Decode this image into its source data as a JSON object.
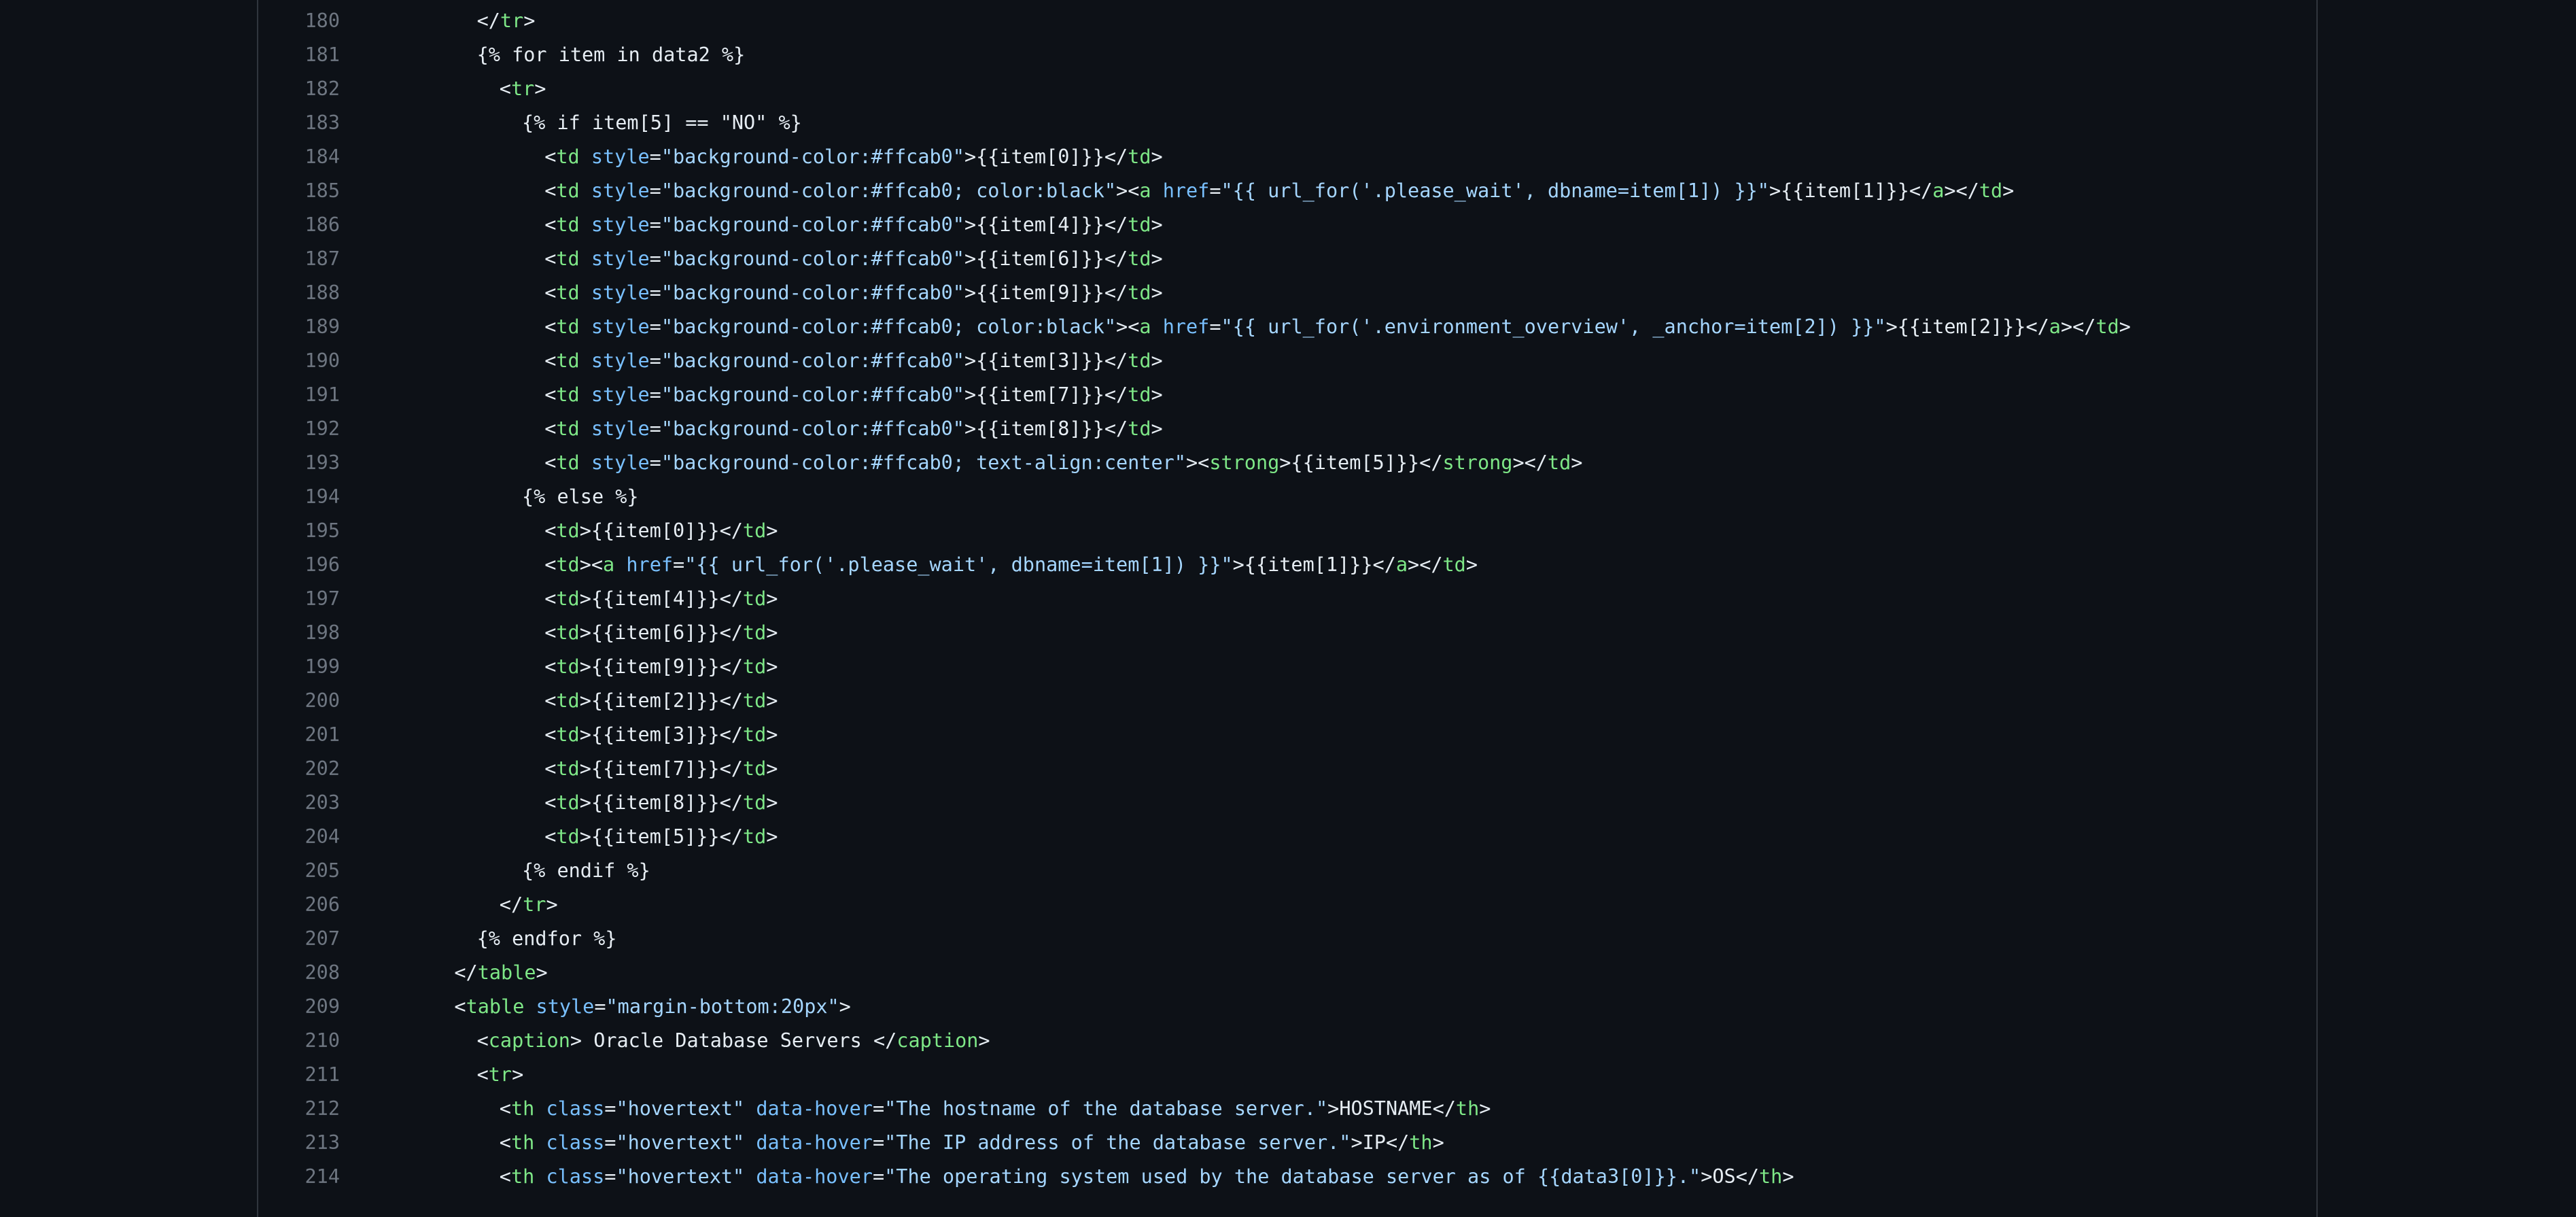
{
  "colors": {
    "background": "#0d1117",
    "line_number": "#6e7681",
    "text": "#e6edf3",
    "tag": "#7ee787",
    "attribute": "#79c0ff",
    "string": "#a5d6ff"
  },
  "lines": [
    {
      "num": "180",
      "indent": 6,
      "tokens": [
        [
          "p",
          "</"
        ],
        [
          "t",
          "tr"
        ],
        [
          "p",
          ">"
        ]
      ]
    },
    {
      "num": "181",
      "indent": 6,
      "tokens": [
        [
          "p",
          "{% for item in data2 %}"
        ]
      ]
    },
    {
      "num": "182",
      "indent": 8,
      "tokens": [
        [
          "p",
          "<"
        ],
        [
          "t",
          "tr"
        ],
        [
          "p",
          ">"
        ]
      ]
    },
    {
      "num": "183",
      "indent": 10,
      "tokens": [
        [
          "p",
          "{% if item[5] == \"NO\" %}"
        ]
      ]
    },
    {
      "num": "184",
      "indent": 12,
      "tokens": [
        [
          "p",
          "<"
        ],
        [
          "t",
          "td"
        ],
        [
          "p",
          " "
        ],
        [
          "a",
          "style"
        ],
        [
          "p",
          "="
        ],
        [
          "s",
          "\"background-color:#ffcab0\""
        ],
        [
          "p",
          ">{{item[0]}}</"
        ],
        [
          "t",
          "td"
        ],
        [
          "p",
          ">"
        ]
      ]
    },
    {
      "num": "185",
      "indent": 12,
      "tokens": [
        [
          "p",
          "<"
        ],
        [
          "t",
          "td"
        ],
        [
          "p",
          " "
        ],
        [
          "a",
          "style"
        ],
        [
          "p",
          "="
        ],
        [
          "s",
          "\"background-color:#ffcab0; color:black\""
        ],
        [
          "p",
          ">"
        ],
        [
          "p",
          "<"
        ],
        [
          "t",
          "a"
        ],
        [
          "p",
          " "
        ],
        [
          "a",
          "href"
        ],
        [
          "p",
          "="
        ],
        [
          "s",
          "\"{{ url_for('.please_wait', dbname=item[1]) }}\""
        ],
        [
          "p",
          ">{{item[1]}}</"
        ],
        [
          "t",
          "a"
        ],
        [
          "p",
          "></"
        ],
        [
          "t",
          "td"
        ],
        [
          "p",
          ">"
        ]
      ]
    },
    {
      "num": "186",
      "indent": 12,
      "tokens": [
        [
          "p",
          "<"
        ],
        [
          "t",
          "td"
        ],
        [
          "p",
          " "
        ],
        [
          "a",
          "style"
        ],
        [
          "p",
          "="
        ],
        [
          "s",
          "\"background-color:#ffcab0\""
        ],
        [
          "p",
          ">{{item[4]}}</"
        ],
        [
          "t",
          "td"
        ],
        [
          "p",
          ">"
        ]
      ]
    },
    {
      "num": "187",
      "indent": 12,
      "tokens": [
        [
          "p",
          "<"
        ],
        [
          "t",
          "td"
        ],
        [
          "p",
          " "
        ],
        [
          "a",
          "style"
        ],
        [
          "p",
          "="
        ],
        [
          "s",
          "\"background-color:#ffcab0\""
        ],
        [
          "p",
          ">{{item[6]}}</"
        ],
        [
          "t",
          "td"
        ],
        [
          "p",
          ">"
        ]
      ]
    },
    {
      "num": "188",
      "indent": 12,
      "tokens": [
        [
          "p",
          "<"
        ],
        [
          "t",
          "td"
        ],
        [
          "p",
          " "
        ],
        [
          "a",
          "style"
        ],
        [
          "p",
          "="
        ],
        [
          "s",
          "\"background-color:#ffcab0\""
        ],
        [
          "p",
          ">{{item[9]}}</"
        ],
        [
          "t",
          "td"
        ],
        [
          "p",
          ">"
        ]
      ]
    },
    {
      "num": "189",
      "indent": 12,
      "tokens": [
        [
          "p",
          "<"
        ],
        [
          "t",
          "td"
        ],
        [
          "p",
          " "
        ],
        [
          "a",
          "style"
        ],
        [
          "p",
          "="
        ],
        [
          "s",
          "\"background-color:#ffcab0; color:black\""
        ],
        [
          "p",
          ">"
        ],
        [
          "p",
          "<"
        ],
        [
          "t",
          "a"
        ],
        [
          "p",
          " "
        ],
        [
          "a",
          "href"
        ],
        [
          "p",
          "="
        ],
        [
          "s",
          "\"{{ url_for('.environment_overview', _anchor=item[2]) }}\""
        ],
        [
          "p",
          ">{{item[2]}}</"
        ],
        [
          "t",
          "a"
        ],
        [
          "p",
          "></"
        ],
        [
          "t",
          "td"
        ],
        [
          "p",
          ">"
        ]
      ]
    },
    {
      "num": "190",
      "indent": 12,
      "tokens": [
        [
          "p",
          "<"
        ],
        [
          "t",
          "td"
        ],
        [
          "p",
          " "
        ],
        [
          "a",
          "style"
        ],
        [
          "p",
          "="
        ],
        [
          "s",
          "\"background-color:#ffcab0\""
        ],
        [
          "p",
          ">{{item[3]}}</"
        ],
        [
          "t",
          "td"
        ],
        [
          "p",
          ">"
        ]
      ]
    },
    {
      "num": "191",
      "indent": 12,
      "tokens": [
        [
          "p",
          "<"
        ],
        [
          "t",
          "td"
        ],
        [
          "p",
          " "
        ],
        [
          "a",
          "style"
        ],
        [
          "p",
          "="
        ],
        [
          "s",
          "\"background-color:#ffcab0\""
        ],
        [
          "p",
          ">{{item[7]}}</"
        ],
        [
          "t",
          "td"
        ],
        [
          "p",
          ">"
        ]
      ]
    },
    {
      "num": "192",
      "indent": 12,
      "tokens": [
        [
          "p",
          "<"
        ],
        [
          "t",
          "td"
        ],
        [
          "p",
          " "
        ],
        [
          "a",
          "style"
        ],
        [
          "p",
          "="
        ],
        [
          "s",
          "\"background-color:#ffcab0\""
        ],
        [
          "p",
          ">{{item[8]}}</"
        ],
        [
          "t",
          "td"
        ],
        [
          "p",
          ">"
        ]
      ]
    },
    {
      "num": "193",
      "indent": 12,
      "tokens": [
        [
          "p",
          "<"
        ],
        [
          "t",
          "td"
        ],
        [
          "p",
          " "
        ],
        [
          "a",
          "style"
        ],
        [
          "p",
          "="
        ],
        [
          "s",
          "\"background-color:#ffcab0; text-align:center\""
        ],
        [
          "p",
          ">"
        ],
        [
          "p",
          "<"
        ],
        [
          "t",
          "strong"
        ],
        [
          "p",
          ">{{item[5]}}</"
        ],
        [
          "t",
          "strong"
        ],
        [
          "p",
          "></"
        ],
        [
          "t",
          "td"
        ],
        [
          "p",
          ">"
        ]
      ]
    },
    {
      "num": "194",
      "indent": 10,
      "tokens": [
        [
          "p",
          "{% else %}"
        ]
      ]
    },
    {
      "num": "195",
      "indent": 12,
      "tokens": [
        [
          "p",
          "<"
        ],
        [
          "t",
          "td"
        ],
        [
          "p",
          ">{{item[0]}}</"
        ],
        [
          "t",
          "td"
        ],
        [
          "p",
          ">"
        ]
      ]
    },
    {
      "num": "196",
      "indent": 12,
      "tokens": [
        [
          "p",
          "<"
        ],
        [
          "t",
          "td"
        ],
        [
          "p",
          ">"
        ],
        [
          "p",
          "<"
        ],
        [
          "t",
          "a"
        ],
        [
          "p",
          " "
        ],
        [
          "a",
          "href"
        ],
        [
          "p",
          "="
        ],
        [
          "s",
          "\"{{ url_for('.please_wait', dbname=item[1]) }}\""
        ],
        [
          "p",
          ">{{item[1]}}</"
        ],
        [
          "t",
          "a"
        ],
        [
          "p",
          "></"
        ],
        [
          "t",
          "td"
        ],
        [
          "p",
          ">"
        ]
      ]
    },
    {
      "num": "197",
      "indent": 12,
      "tokens": [
        [
          "p",
          "<"
        ],
        [
          "t",
          "td"
        ],
        [
          "p",
          ">{{item[4]}}</"
        ],
        [
          "t",
          "td"
        ],
        [
          "p",
          ">"
        ]
      ]
    },
    {
      "num": "198",
      "indent": 12,
      "tokens": [
        [
          "p",
          "<"
        ],
        [
          "t",
          "td"
        ],
        [
          "p",
          ">{{item[6]}}</"
        ],
        [
          "t",
          "td"
        ],
        [
          "p",
          ">"
        ]
      ]
    },
    {
      "num": "199",
      "indent": 12,
      "tokens": [
        [
          "p",
          "<"
        ],
        [
          "t",
          "td"
        ],
        [
          "p",
          ">{{item[9]}}</"
        ],
        [
          "t",
          "td"
        ],
        [
          "p",
          ">"
        ]
      ]
    },
    {
      "num": "200",
      "indent": 12,
      "tokens": [
        [
          "p",
          "<"
        ],
        [
          "t",
          "td"
        ],
        [
          "p",
          ">{{item[2]}}</"
        ],
        [
          "t",
          "td"
        ],
        [
          "p",
          ">"
        ]
      ]
    },
    {
      "num": "201",
      "indent": 12,
      "tokens": [
        [
          "p",
          "<"
        ],
        [
          "t",
          "td"
        ],
        [
          "p",
          ">{{item[3]}}</"
        ],
        [
          "t",
          "td"
        ],
        [
          "p",
          ">"
        ]
      ]
    },
    {
      "num": "202",
      "indent": 12,
      "tokens": [
        [
          "p",
          "<"
        ],
        [
          "t",
          "td"
        ],
        [
          "p",
          ">{{item[7]}}</"
        ],
        [
          "t",
          "td"
        ],
        [
          "p",
          ">"
        ]
      ]
    },
    {
      "num": "203",
      "indent": 12,
      "tokens": [
        [
          "p",
          "<"
        ],
        [
          "t",
          "td"
        ],
        [
          "p",
          ">{{item[8]}}</"
        ],
        [
          "t",
          "td"
        ],
        [
          "p",
          ">"
        ]
      ]
    },
    {
      "num": "204",
      "indent": 12,
      "tokens": [
        [
          "p",
          "<"
        ],
        [
          "t",
          "td"
        ],
        [
          "p",
          ">{{item[5]}}</"
        ],
        [
          "t",
          "td"
        ],
        [
          "p",
          ">"
        ]
      ]
    },
    {
      "num": "205",
      "indent": 10,
      "tokens": [
        [
          "p",
          "{% endif %}"
        ]
      ]
    },
    {
      "num": "206",
      "indent": 8,
      "tokens": [
        [
          "p",
          "</"
        ],
        [
          "t",
          "tr"
        ],
        [
          "p",
          ">"
        ]
      ]
    },
    {
      "num": "207",
      "indent": 6,
      "tokens": [
        [
          "p",
          "{% endfor %}"
        ]
      ]
    },
    {
      "num": "208",
      "indent": 4,
      "tokens": [
        [
          "p",
          "</"
        ],
        [
          "t",
          "table"
        ],
        [
          "p",
          ">"
        ]
      ]
    },
    {
      "num": "209",
      "indent": 4,
      "tokens": [
        [
          "p",
          "<"
        ],
        [
          "t",
          "table"
        ],
        [
          "p",
          " "
        ],
        [
          "a",
          "style"
        ],
        [
          "p",
          "="
        ],
        [
          "s",
          "\"margin-bottom:20px\""
        ],
        [
          "p",
          ">"
        ]
      ]
    },
    {
      "num": "210",
      "indent": 6,
      "tokens": [
        [
          "p",
          "<"
        ],
        [
          "t",
          "caption"
        ],
        [
          "p",
          "> Oracle Database Servers </"
        ],
        [
          "t",
          "caption"
        ],
        [
          "p",
          ">"
        ]
      ]
    },
    {
      "num": "211",
      "indent": 6,
      "tokens": [
        [
          "p",
          "<"
        ],
        [
          "t",
          "tr"
        ],
        [
          "p",
          ">"
        ]
      ]
    },
    {
      "num": "212",
      "indent": 8,
      "tokens": [
        [
          "p",
          "<"
        ],
        [
          "t",
          "th"
        ],
        [
          "p",
          " "
        ],
        [
          "a",
          "class"
        ],
        [
          "p",
          "="
        ],
        [
          "s",
          "\"hovertext\""
        ],
        [
          "p",
          " "
        ],
        [
          "a",
          "data-hover"
        ],
        [
          "p",
          "="
        ],
        [
          "s",
          "\"The hostname of the database server.\""
        ],
        [
          "p",
          ">HOSTNAME</"
        ],
        [
          "t",
          "th"
        ],
        [
          "p",
          ">"
        ]
      ]
    },
    {
      "num": "213",
      "indent": 8,
      "tokens": [
        [
          "p",
          "<"
        ],
        [
          "t",
          "th"
        ],
        [
          "p",
          " "
        ],
        [
          "a",
          "class"
        ],
        [
          "p",
          "="
        ],
        [
          "s",
          "\"hovertext\""
        ],
        [
          "p",
          " "
        ],
        [
          "a",
          "data-hover"
        ],
        [
          "p",
          "="
        ],
        [
          "s",
          "\"The IP address of the database server.\""
        ],
        [
          "p",
          ">IP</"
        ],
        [
          "t",
          "th"
        ],
        [
          "p",
          ">"
        ]
      ]
    },
    {
      "num": "214",
      "indent": 8,
      "tokens": [
        [
          "p",
          "<"
        ],
        [
          "t",
          "th"
        ],
        [
          "p",
          " "
        ],
        [
          "a",
          "class"
        ],
        [
          "p",
          "="
        ],
        [
          "s",
          "\"hovertext\""
        ],
        [
          "p",
          " "
        ],
        [
          "a",
          "data-hover"
        ],
        [
          "p",
          "="
        ],
        [
          "s",
          "\"The operating system used by the database server as of {{data3[0]}}.\""
        ],
        [
          "p",
          ">OS</"
        ],
        [
          "t",
          "th"
        ],
        [
          "p",
          ">"
        ]
      ]
    }
  ]
}
